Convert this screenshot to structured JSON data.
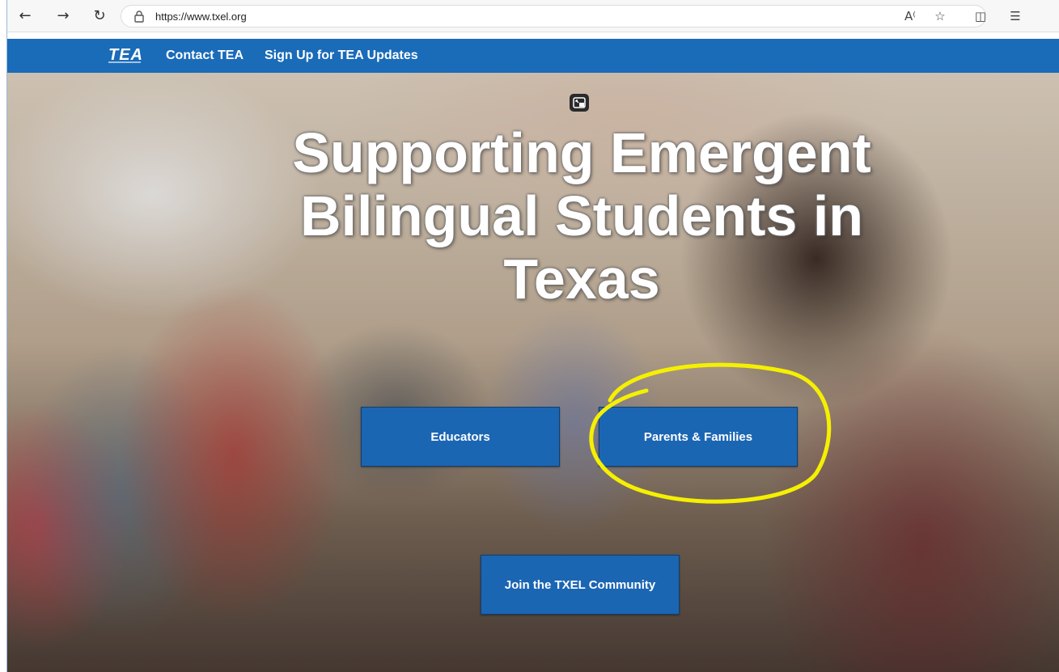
{
  "browser": {
    "url": "https://www.txel.org",
    "icons": [
      "back-arrow-icon",
      "forward-arrow-icon",
      "refresh-icon",
      "lock-icon",
      "read-aloud-icon",
      "favorite-star-icon",
      "split-screen-icon",
      "favorites-list-icon"
    ]
  },
  "site_header": {
    "logo_text": "TEA",
    "nav": {
      "contact": "Contact TEA",
      "signup": "Sign Up for TEA Updates"
    },
    "color": "#1a6bb8"
  },
  "hero": {
    "title_line1": "Supporting Emergent",
    "title_line2": "Bilingual Students in",
    "title_line3": "Texas",
    "buttons": {
      "educators": "Educators",
      "parents": "Parents & Families",
      "community": "Join the TXEL Community"
    },
    "button_color": "#1b66b3",
    "highlight_color": "#f5f000"
  }
}
